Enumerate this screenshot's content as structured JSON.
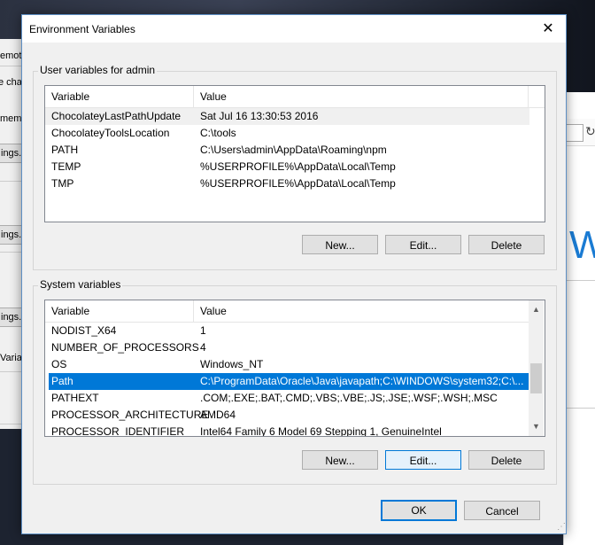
{
  "background_left": {
    "fragments": [
      "emote",
      "e cha",
      "mem",
      "ings..",
      "ings..",
      "ings..",
      "Varia"
    ]
  },
  "background_right": {
    "refresh_icon": "↻",
    "big_letter": "W"
  },
  "dialog": {
    "title": "Environment Variables",
    "close_glyph": "✕"
  },
  "user_vars": {
    "label": "User variables for admin",
    "columns": [
      "Variable",
      "Value"
    ],
    "rows": [
      {
        "name": "ChocolateyLastPathUpdate",
        "value": "Sat Jul 16 13:30:53 2016"
      },
      {
        "name": "ChocolateyToolsLocation",
        "value": "C:\\tools"
      },
      {
        "name": "PATH",
        "value": "C:\\Users\\admin\\AppData\\Roaming\\npm"
      },
      {
        "name": "TEMP",
        "value": "%USERPROFILE%\\AppData\\Local\\Temp"
      },
      {
        "name": "TMP",
        "value": "%USERPROFILE%\\AppData\\Local\\Temp"
      }
    ],
    "buttons": {
      "new": "New...",
      "edit": "Edit...",
      "delete": "Delete"
    }
  },
  "system_vars": {
    "label": "System variables",
    "columns": [
      "Variable",
      "Value"
    ],
    "rows": [
      {
        "name": "NODIST_X64",
        "value": "1"
      },
      {
        "name": "NUMBER_OF_PROCESSORS",
        "value": "4"
      },
      {
        "name": "OS",
        "value": "Windows_NT"
      },
      {
        "name": "Path",
        "value": "C:\\ProgramData\\Oracle\\Java\\javapath;C:\\WINDOWS\\system32;C:\\..."
      },
      {
        "name": "PATHEXT",
        "value": ".COM;.EXE;.BAT;.CMD;.VBS;.VBE;.JS;.JSE;.WSF;.WSH;.MSC"
      },
      {
        "name": "PROCESSOR_ARCHITECTURE",
        "value": "AMD64"
      },
      {
        "name": "PROCESSOR_IDENTIFIER",
        "value": "Intel64 Family 6 Model 69 Stepping 1, GenuineIntel"
      }
    ],
    "selected_row": "Path",
    "buttons": {
      "new": "New...",
      "edit": "Edit...",
      "delete": "Delete"
    },
    "scroll_up_glyph": "▲",
    "scroll_down_glyph": "▼"
  },
  "footer": {
    "ok": "OK",
    "cancel": "Cancel"
  },
  "colors": {
    "selection": "#0078d7",
    "accent_border": "#5e8fc4"
  }
}
